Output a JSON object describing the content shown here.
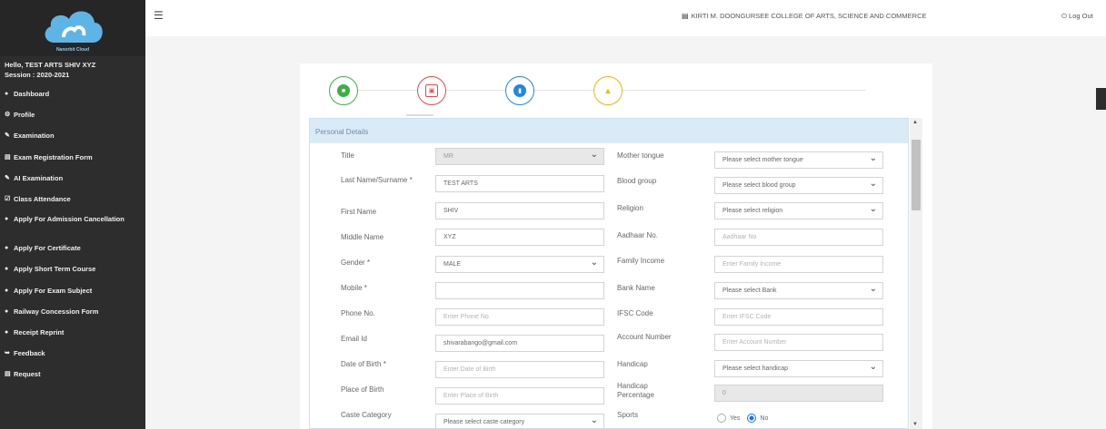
{
  "sidebar": {
    "logo_text": "Nanorbit Cloud",
    "user_line": "Hello, TEST ARTS SHIV XYZ",
    "session_line": "Session : 2020-2021",
    "menu": [
      {
        "label": "Dashboard",
        "icon": "dashboard-icon"
      },
      {
        "label": "Profile",
        "icon": "gear-icon"
      },
      {
        "label": "Examination",
        "icon": "pencil-icon"
      },
      {
        "label": "Exam Registration Form",
        "icon": "form-icon"
      },
      {
        "label": "AI Examination",
        "icon": "pencil-icon"
      },
      {
        "label": "Class Attendance",
        "icon": "check-icon"
      },
      {
        "label": "Apply For Admission Cancellation",
        "icon": "dot-icon"
      },
      {
        "label": "Apply For Certificate",
        "icon": "dot-icon"
      },
      {
        "label": "Apply Short Term Course",
        "icon": "dot-icon"
      },
      {
        "label": "Apply For Exam Subject",
        "icon": "dot-icon"
      },
      {
        "label": "Railway Concession Form",
        "icon": "dot-icon"
      },
      {
        "label": "Receipt Reprint",
        "icon": "dot-icon"
      },
      {
        "label": "Feedback",
        "icon": "feedback-icon"
      },
      {
        "label": "Request",
        "icon": "request-icon"
      }
    ]
  },
  "topbar": {
    "college": "KIRTI M. DOONGURSEE COLLEGE OF ARTS, SCIENCE AND COMMERCE",
    "logout": "Log Out"
  },
  "steps": [
    {
      "icon": "personal-icon",
      "color": "#3cb043"
    },
    {
      "icon": "address-icon",
      "color": "#e24a4a"
    },
    {
      "icon": "education-icon",
      "color": "#1e88e5"
    },
    {
      "icon": "warning-icon",
      "color": "#f5b301"
    }
  ],
  "panel": {
    "heading": "Personal Details",
    "left": [
      {
        "label": "Title",
        "value": "MR",
        "kind": "select-disabled"
      },
      {
        "label": "Last Name/Surname *",
        "value": "TEST ARTS",
        "kind": "text"
      },
      {
        "label": "First Name",
        "value": "SHIV",
        "kind": "text"
      },
      {
        "label": "Middle Name",
        "value": "XYZ",
        "kind": "text"
      },
      {
        "label": "Gender *",
        "value": "MALE",
        "kind": "select"
      },
      {
        "label": "Mobile *",
        "value": "",
        "kind": "text"
      },
      {
        "label": "Phone No.",
        "placeholder": "Enter Phone No",
        "kind": "text"
      },
      {
        "label": "Email Id",
        "value": "shivarabango@gmail.com",
        "kind": "text"
      },
      {
        "label": "Date of Birth *",
        "placeholder": "Enter Date of Birth",
        "kind": "text"
      },
      {
        "label": "Place of Birth",
        "placeholder": "Enter Place of Birth",
        "kind": "text"
      },
      {
        "label": "Caste Category",
        "value": "Please select caste category",
        "kind": "select"
      }
    ],
    "right": [
      {
        "label": "Mother tongue",
        "value": "Please select mother tongue",
        "kind": "select"
      },
      {
        "label": "Blood group",
        "value": "Please select blood group",
        "kind": "select"
      },
      {
        "label": "Religion",
        "value": "Please select religion",
        "kind": "select"
      },
      {
        "label": "Aadhaar No.",
        "placeholder": "Aadhaar No",
        "kind": "text"
      },
      {
        "label": "Family Income",
        "placeholder": "Enter Family Income",
        "kind": "text"
      },
      {
        "label": "Bank Name",
        "value": "Please select Bank",
        "kind": "select"
      },
      {
        "label": "IFSC Code",
        "placeholder": "Enter IFSC Code",
        "kind": "text"
      },
      {
        "label": "Account Number",
        "placeholder": "Enter Account Number",
        "kind": "text"
      },
      {
        "label": "Handicap",
        "value": "Please select handicap",
        "kind": "select"
      },
      {
        "label": "Handicap Percentage",
        "value": "0",
        "kind": "disabled"
      },
      {
        "label": "Sports",
        "kind": "radio",
        "options": [
          "Yes",
          "No"
        ],
        "selected": "No"
      }
    ]
  }
}
